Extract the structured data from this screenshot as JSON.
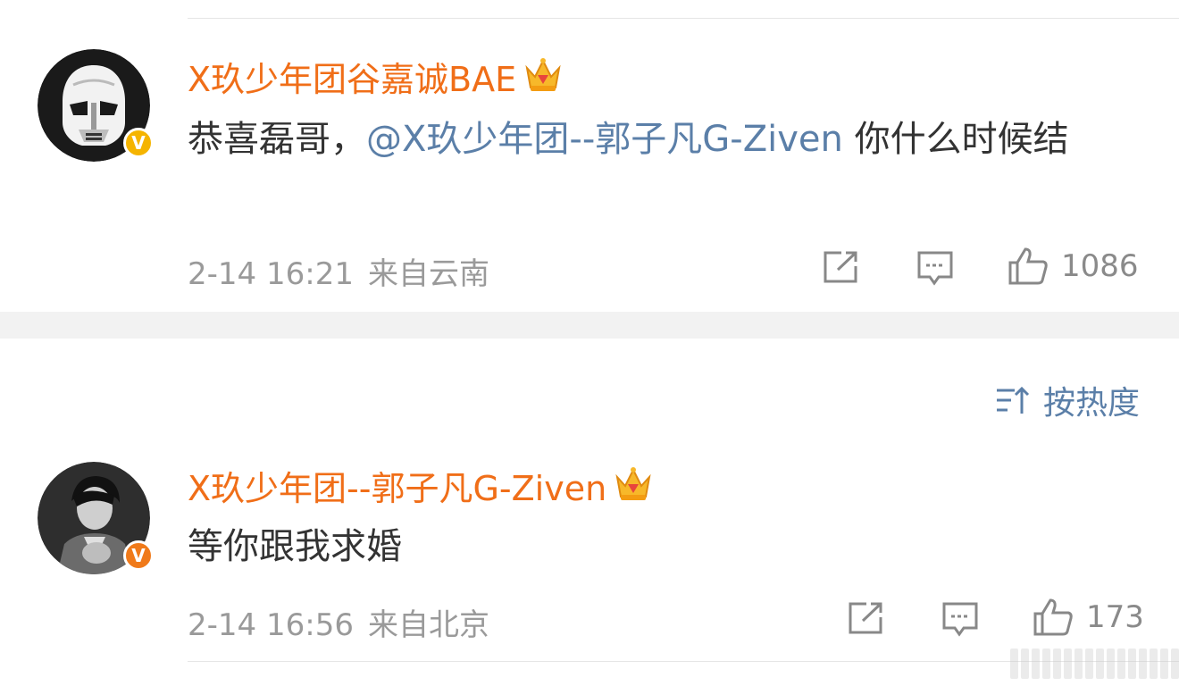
{
  "comments": [
    {
      "username": "X玖少年团谷嘉诚BAE",
      "text_before": "恭喜磊哥，",
      "mention": "@X玖少年团--郭子凡G-Ziven",
      "text_after": "你什么时候结",
      "date": "2-14 16:21",
      "source": "来自云南",
      "likes": "1086",
      "badge": "V",
      "badge_color": "#f5b400"
    },
    {
      "username": "X玖少年团--郭子凡G-Ziven",
      "text": "等你跟我求婚",
      "date": "2-14 16:56",
      "source": "来自北京",
      "likes": "173",
      "badge": "V",
      "badge_color": "#f07a1a"
    }
  ],
  "sort": {
    "label": "按热度",
    "icon": "sort-icon"
  },
  "colors": {
    "username": "#f06e18",
    "mention": "#5b7fa8",
    "meta": "#9a9a9a"
  }
}
